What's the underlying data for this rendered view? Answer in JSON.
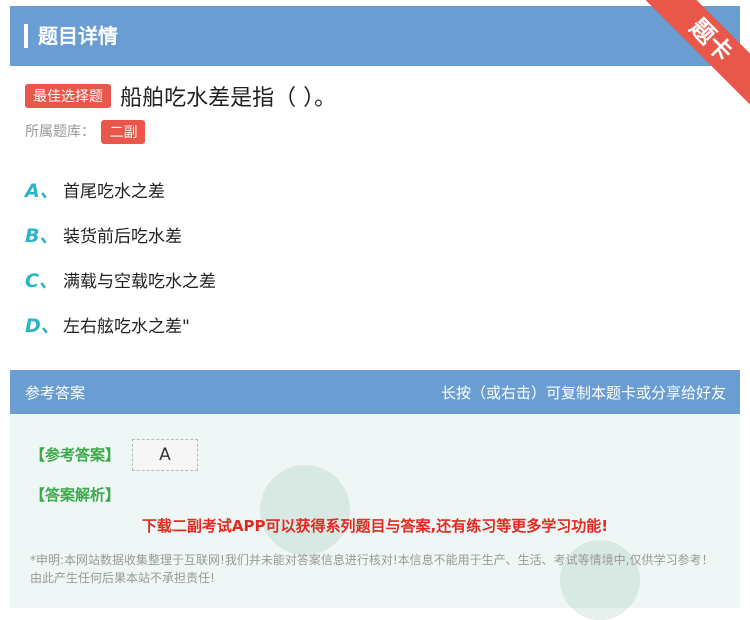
{
  "header": {
    "title": "题目详情"
  },
  "ribbon": {
    "label": "题卡"
  },
  "question": {
    "badge": "最佳选择题",
    "text": "船舶吃水差是指（ ）。"
  },
  "bank": {
    "label": "所属题库：",
    "value": "二副"
  },
  "options": [
    {
      "letter": "A、",
      "text": "首尾吃水之差"
    },
    {
      "letter": "B、",
      "text": "装货前后吃水差"
    },
    {
      "letter": "C、",
      "text": "满载与空载吃水之差"
    },
    {
      "letter": "D、",
      "text": "左右舷吃水之差\""
    }
  ],
  "answer_panel": {
    "title": "参考答案",
    "hint": "长按（或右击）可复制本题卡或分享给好友",
    "answer_label": "【参考答案】",
    "answer_value": "A",
    "analysis_label": "【答案解析】",
    "promo": "下载二副考试APP可以获得系列题目与答案,还有练习等更多学习功能!",
    "disclaimer": "*申明:本网站数据收集整理于互联网!我们并未能对答案信息进行核对!本信息不能用于生产、生活、考试等情境中,仅供学习参考！由此产生任何后果本站不承担责任!"
  },
  "colors": {
    "header": "#6a9ed3",
    "badge": "#e9564a",
    "option_letter": "#2ab5c5",
    "answer_green": "#3caa4a",
    "promo_red": "#e12a20"
  }
}
